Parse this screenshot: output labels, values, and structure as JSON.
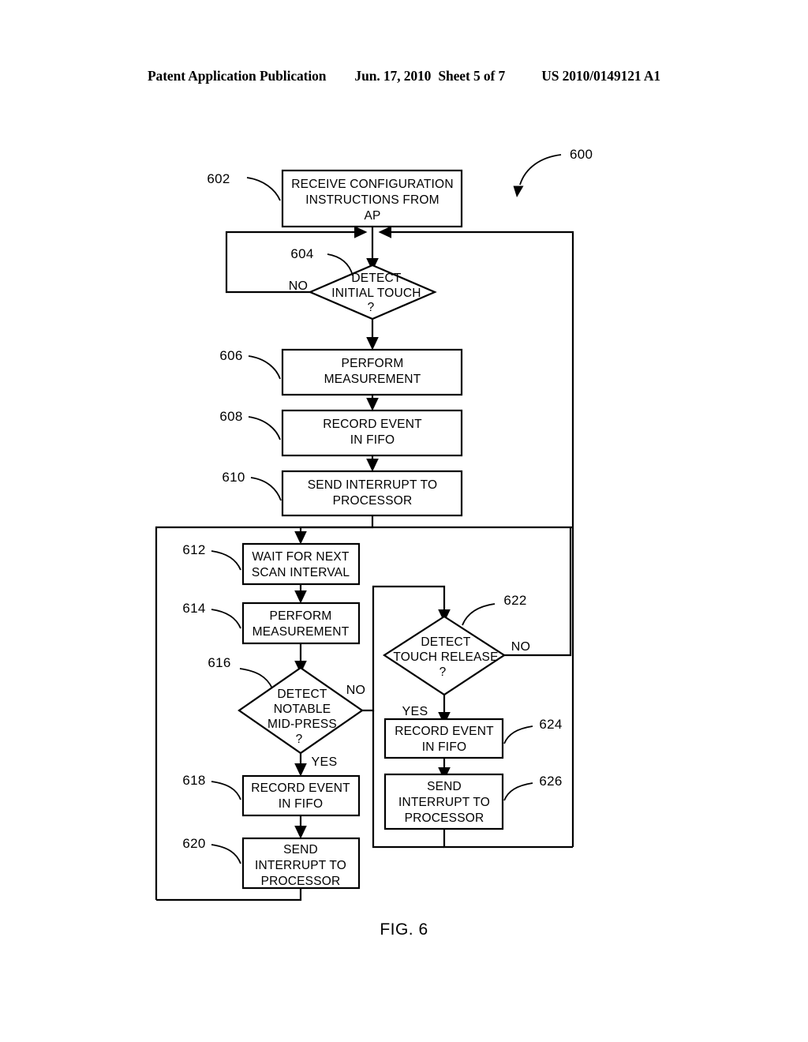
{
  "header": {
    "publication": "Patent Application Publication",
    "date": "Jun. 17, 2010",
    "sheet": "Sheet 5 of 7",
    "patent_number": "US 2010/0149121 A1"
  },
  "figure": {
    "caption": "FIG. 6",
    "diagram_ref": "600"
  },
  "nodes": {
    "n602": {
      "ref": "602",
      "line1": "RECEIVE CONFIGURATION",
      "line2": "INSTRUCTIONS FROM",
      "line3": "AP"
    },
    "n604": {
      "ref": "604",
      "line1": "DETECT",
      "line2": "INITIAL TOUCH",
      "line3": "?"
    },
    "n606": {
      "ref": "606",
      "line1": "PERFORM",
      "line2": "MEASUREMENT"
    },
    "n608": {
      "ref": "608",
      "line1": "RECORD EVENT",
      "line2": "IN FIFO"
    },
    "n610": {
      "ref": "610",
      "line1": "SEND INTERRUPT TO",
      "line2": "PROCESSOR"
    },
    "n612": {
      "ref": "612",
      "line1": "WAIT FOR NEXT",
      "line2": "SCAN INTERVAL"
    },
    "n614": {
      "ref": "614",
      "line1": "PERFORM",
      "line2": "MEASUREMENT"
    },
    "n616": {
      "ref": "616",
      "line1": "DETECT",
      "line2": "NOTABLE",
      "line3": "MID-PRESS",
      "line4": "?"
    },
    "n618": {
      "ref": "618",
      "line1": "RECORD EVENT",
      "line2": "IN FIFO"
    },
    "n620": {
      "ref": "620",
      "line1": "SEND",
      "line2": "INTERRUPT TO",
      "line3": "PROCESSOR"
    },
    "n622": {
      "ref": "622",
      "line1": "DETECT",
      "line2": "TOUCH RELEASE",
      "line3": "?"
    },
    "n624": {
      "ref": "624",
      "line1": "RECORD EVENT",
      "line2": "IN FIFO"
    },
    "n626": {
      "ref": "626",
      "line1": "SEND",
      "line2": "INTERRUPT TO",
      "line3": "PROCESSOR"
    }
  },
  "edge_labels": {
    "e604_no": "NO",
    "e616_no": "NO",
    "e616_yes": "YES",
    "e622_no": "NO",
    "e622_yes": "YES"
  },
  "colors": {
    "ink": "#000000",
    "paper": "#ffffff"
  }
}
